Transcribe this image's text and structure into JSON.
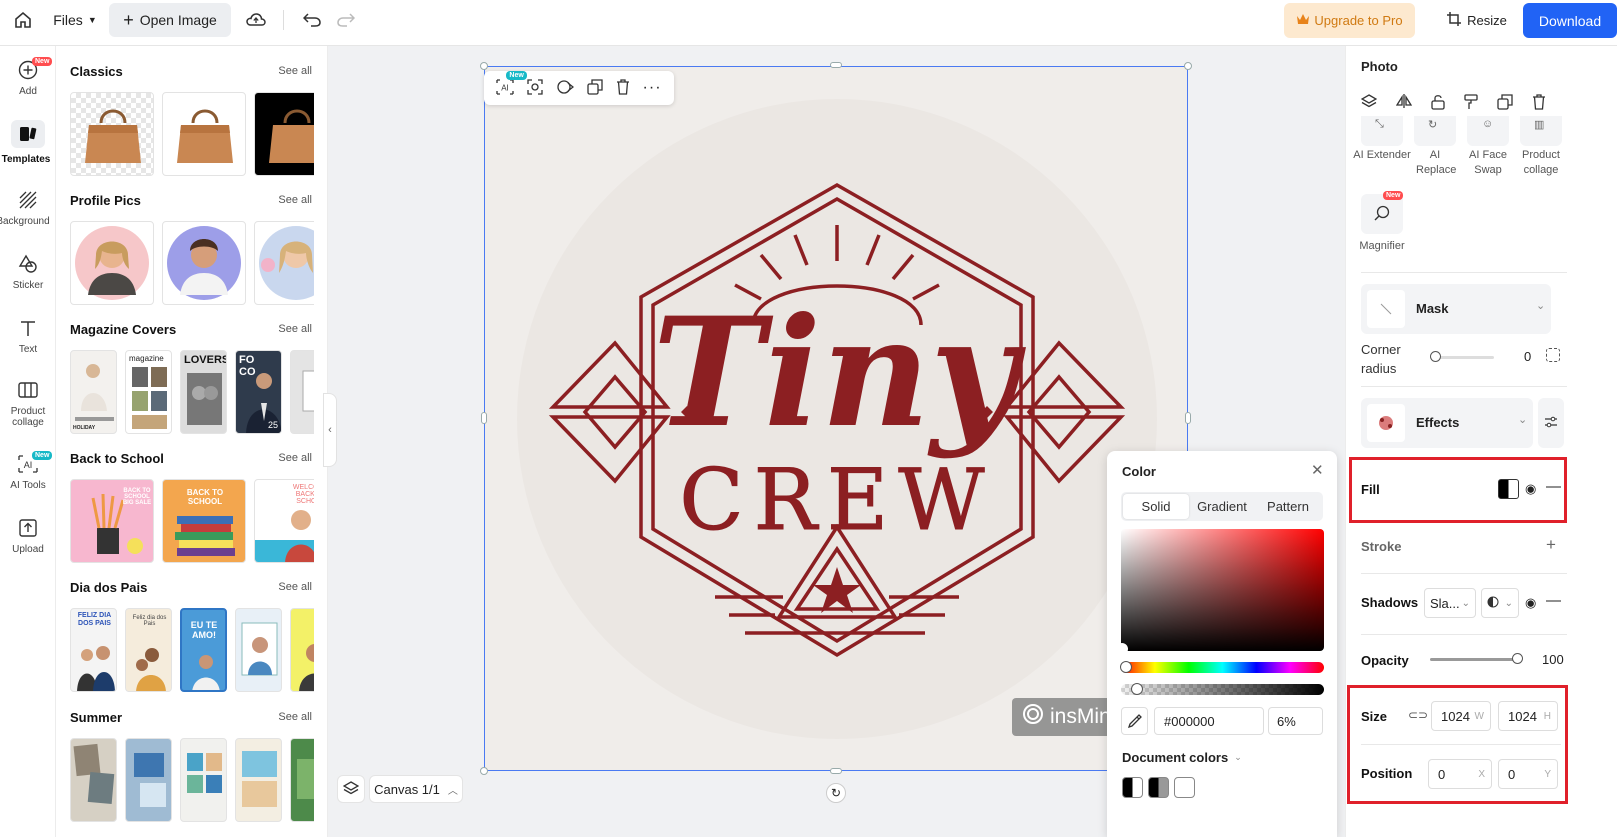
{
  "topbar": {
    "files_label": "Files",
    "open_image_label": "Open Image",
    "upgrade_label": "Upgrade to Pro",
    "resize_label": "Resize",
    "download_label": "Download"
  },
  "leftnav": {
    "items": [
      {
        "label": "Add",
        "badge": "New"
      },
      {
        "label": "Templates"
      },
      {
        "label": "Background"
      },
      {
        "label": "Sticker"
      },
      {
        "label": "Text"
      },
      {
        "label": "Product collage"
      },
      {
        "label": "AI Tools",
        "badge": "New"
      },
      {
        "label": "Upload"
      }
    ]
  },
  "templates": {
    "see_all": "See all",
    "sections": [
      {
        "title": "Classics"
      },
      {
        "title": "Profile Pics"
      },
      {
        "title": "Magazine Covers"
      },
      {
        "title": "Back to School"
      },
      {
        "title": "Dia dos Pais"
      },
      {
        "title": "Summer"
      }
    ],
    "thumb_texts": {
      "magazine": "magazine",
      "lovers": "LOVERS",
      "foco": "FOCO",
      "holiday": "HOLIDAY",
      "num25": "25",
      "school1": "BACK TO SCHOOL BIG SALE",
      "school2": "BACK TO SCHOOL",
      "school3": "WELCOME BACK TO SCHOOL",
      "pais1": "FELIZ DIA DOS PAIS",
      "pais2": "Feliz dia dos Pais",
      "pais3": "EU TE AMO!"
    }
  },
  "canvas": {
    "logo_top_text": "Tiny",
    "logo_bottom_text": "CREW",
    "watermark_text": "insMind",
    "canvas_label": "Canvas 1/1",
    "float_badge": "New"
  },
  "color_panel": {
    "title": "Color",
    "tabs": [
      "Solid",
      "Gradient",
      "Pattern"
    ],
    "hex_value": "#000000",
    "opacity_value": "6%",
    "doc_colors_label": "Document colors"
  },
  "right_panel": {
    "title": "Photo",
    "tools": [
      {
        "label": "AI Extender"
      },
      {
        "label": "AI Replace"
      },
      {
        "label": "AI Face Swap"
      },
      {
        "label": "Product collage"
      }
    ],
    "magnifier_label": "Magnifier",
    "magnifier_badge": "New",
    "mask_label": "Mask",
    "corner_radius_label": "Corner radius",
    "corner_radius_value": "0",
    "effects_label": "Effects",
    "fill_label": "Fill",
    "stroke_label": "Stroke",
    "shadows_label": "Shadows",
    "shadows_value": "Sla...",
    "opacity_label": "Opacity",
    "opacity_value": "100",
    "size_label": "Size",
    "width_value": "1024",
    "width_suffix": "W",
    "height_value": "1024",
    "height_suffix": "H",
    "position_label": "Position",
    "x_value": "0",
    "x_suffix": "X",
    "y_value": "0",
    "y_suffix": "Y"
  },
  "colors": {
    "accent": "#2163f5",
    "logo": "#8c1f22",
    "highlight": "#e0202a",
    "upgrade_text": "#d07a12"
  }
}
